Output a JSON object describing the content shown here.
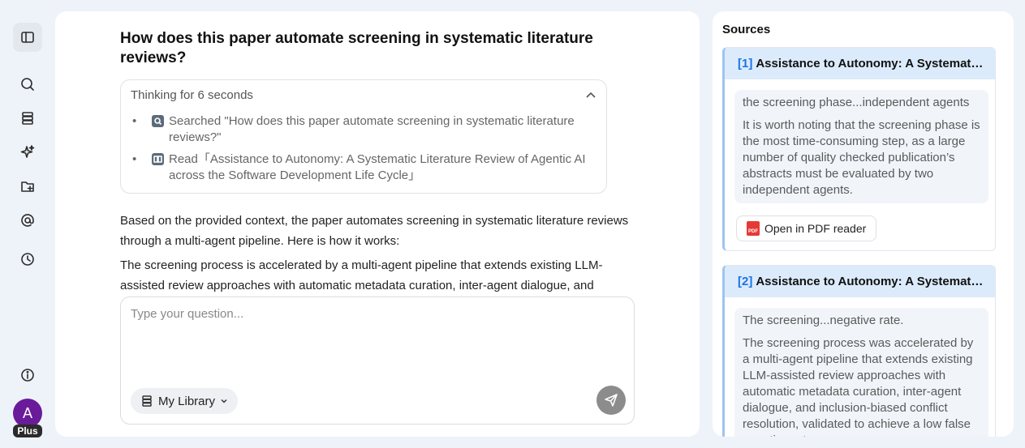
{
  "sidebar": {
    "icons": [
      "panel-toggle-icon",
      "search-icon",
      "library-icon",
      "sparkle-icon",
      "folder-add-icon",
      "at-icon",
      "history-icon",
      "info-icon"
    ],
    "avatar_letter": "A",
    "plan_badge": "Plus"
  },
  "chat": {
    "question": "How does this paper automate screening in systematic literature reviews?",
    "thinking": {
      "header": "Thinking for 6 seconds",
      "steps": [
        {
          "label": "Searched \"How does this paper automate screening in systematic literature reviews?\""
        },
        {
          "label": "Read「Assistance to Autonomy: A Systematic Literature Review of Agentic AI across the Software Development Life Cycle」"
        }
      ]
    },
    "answer": [
      "Based on the provided context, the paper automates screening in systematic literature reviews through a multi-agent pipeline. Here is how it works:",
      "The screening process is accelerated by a multi-agent pipeline that extends existing LLM-assisted review approaches with automatic metadata curation, inter-agent dialogue, and"
    ],
    "input_placeholder": "Type your question...",
    "library_button": "My Library"
  },
  "sources": {
    "title": "Sources",
    "items": [
      {
        "num": "[1]",
        "title": "Assistance to Autonomy: A Systematic Literature Review of Agentic AI across the Software Development Life Cycle",
        "lead": "the screening phase...independent agents",
        "text": "It is worth noting that the screening phase is the most time-consuming step, as a large number of quality checked publication’s abstracts must be evaluated by two independent agents.",
        "button": "Open in PDF reader"
      },
      {
        "num": "[2]",
        "title": "Assistance to Autonomy: A Systematic Literature Review of Agentic AI across the Software Development Life Cycle",
        "lead": "The screening...negative rate.",
        "text": "The screening process was accelerated by a multi-agent pipeline that extends existing LLM-assisted review approaches with automatic metadata curation, inter-agent dialogue, and inclusion-biased conflict resolution, validated to achieve a low false negative rate."
      }
    ]
  },
  "colors": {
    "accent": "#1a73e8",
    "avatar": "#6a1b9a",
    "source_header": "#dcebfb"
  }
}
